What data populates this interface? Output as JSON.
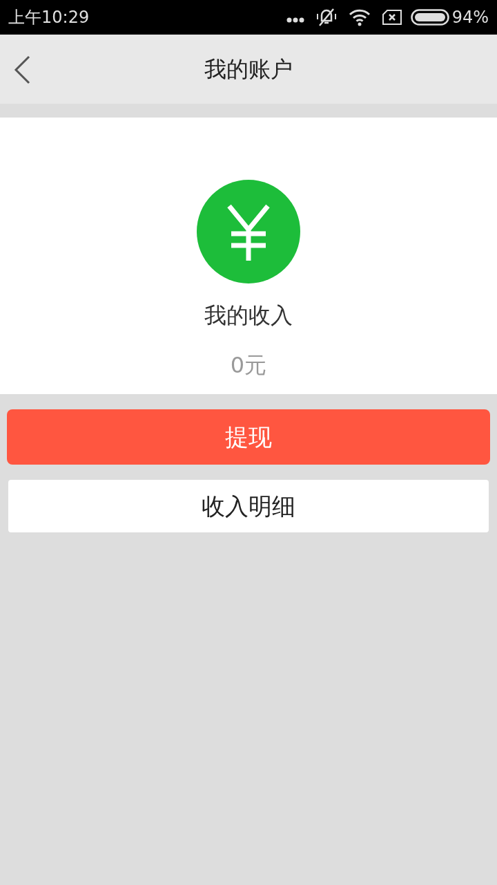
{
  "status_bar": {
    "time": "上午10:29",
    "battery": "94%"
  },
  "header": {
    "title": "我的账户"
  },
  "income": {
    "label": "我的收入",
    "amount": "0元"
  },
  "buttons": [
    {
      "kind": "primary",
      "label": "提现"
    },
    {
      "kind": "secondary",
      "label": "收入明细"
    }
  ]
}
